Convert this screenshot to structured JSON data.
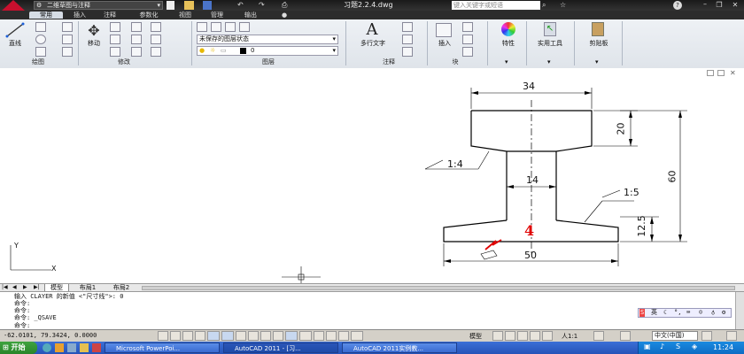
{
  "title_bar": {
    "workspace": "二维草图与注释",
    "document_title": "习题2.2.4.dwg",
    "search_placeholder": "键入关键字或短语"
  },
  "ribbon_tabs": [
    "常用",
    "插入",
    "注释",
    "参数化",
    "视图",
    "管理",
    "输出"
  ],
  "ribbon": {
    "draw_line": "直线",
    "modify_move": "移动",
    "layer_state": "未保存的图层状态",
    "layer_current": "0",
    "multiline_text": "多行文字",
    "insert": "插入",
    "properties": "特性",
    "utilities": "实用工具",
    "clipboard": "剪贴板",
    "groups": [
      "绘图",
      "修改",
      "图层",
      "注释",
      "块"
    ]
  },
  "drawing": {
    "dimensions": {
      "top_width": "34",
      "top_height": "20",
      "total_height": "60",
      "web_width": "14",
      "bottom_height": "12.5",
      "bottom_width": "50",
      "taper_left": "1:4",
      "taper_right": "1:5"
    },
    "annotation_mark": "4",
    "ucs_y": "Y",
    "ucs_x": "X"
  },
  "layout_tabs": [
    "模型",
    "布局1",
    "布局2"
  ],
  "command_lines": [
    "输入 CLAYER 的新值 <\"尺寸线\">: 0",
    "命令:",
    "命令:",
    "命令: _QSAVE",
    "命令:"
  ],
  "status": {
    "coords": "-62.0101, 79.3424, 0.0000",
    "model": "模型",
    "scale": "人1:1",
    "ime": "中文(中国)"
  },
  "taskbar": {
    "start": "开始",
    "tasks": [
      "Microsoft PowerPoi...",
      "AutoCAD 2011 - [习...",
      "AutoCAD 2011实例教..."
    ],
    "clock": "11:24"
  },
  "colors": {
    "ribbon_bg": "#dfe4ea",
    "title_bg": "#1a1a1a",
    "taskbar": "#2653b8",
    "annotation_red": "#e00000"
  }
}
